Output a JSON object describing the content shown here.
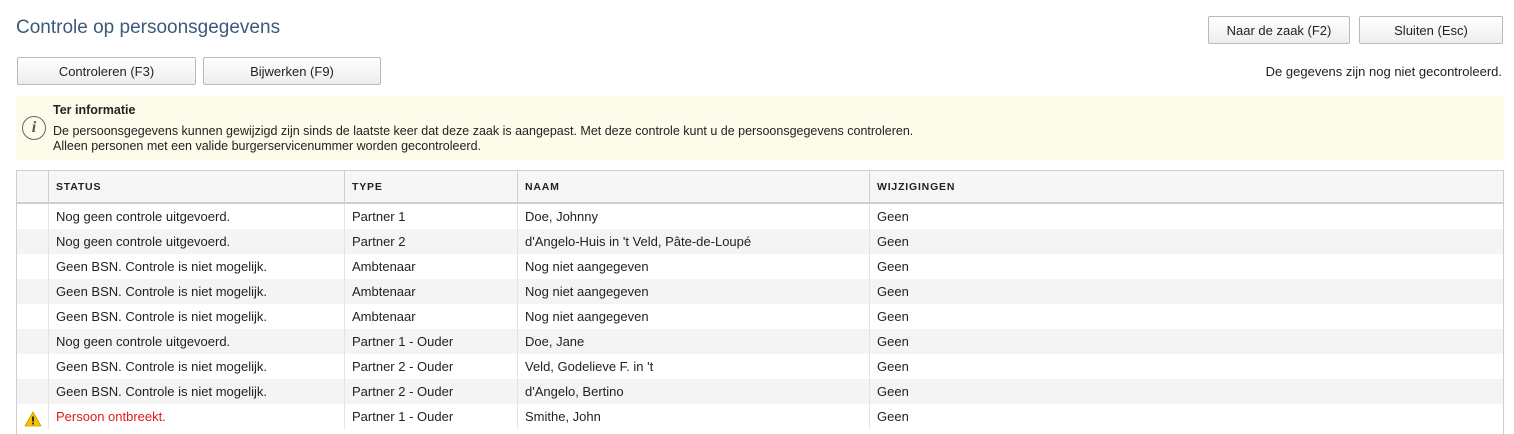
{
  "header": {
    "title": "Controle op persoonsgegevens",
    "naar_zaak_label": "Naar de zaak (F2)",
    "sluiten_label": "Sluiten (Esc)"
  },
  "toolbar": {
    "controleren_label": "Controleren (F3)",
    "bijwerken_label": "Bijwerken (F9)",
    "status_text": "De gegevens zijn nog niet gecontroleerd."
  },
  "info": {
    "title": "Ter informatie",
    "line1": "De persoonsgegevens kunnen gewijzigd zijn sinds de laatste keer dat deze zaak is aangepast. Met deze controle kunt u de persoonsgegevens controleren.",
    "line2": "Alleen personen met een valide burgerservicenummer worden gecontroleerd.",
    "icon": "info-icon"
  },
  "table": {
    "columns": [
      "STATUS",
      "TYPE",
      "NAAM",
      "WIJZIGINGEN"
    ],
    "rows": [
      {
        "status": "Nog geen controle uitgevoerd.",
        "type": "Partner 1",
        "naam": "Doe, Johnny",
        "wijzigingen": "Geen"
      },
      {
        "status": "Nog geen controle uitgevoerd.",
        "type": "Partner 2",
        "naam": "d'Angelo-Huis in 't Veld, Pâte-de-Loupé",
        "wijzigingen": "Geen"
      },
      {
        "status": "Geen BSN. Controle is niet mogelijk.",
        "type": "Ambtenaar",
        "naam": "Nog niet aangegeven",
        "wijzigingen": "Geen"
      },
      {
        "status": "Geen BSN. Controle is niet mogelijk.",
        "type": "Ambtenaar",
        "naam": "Nog niet aangegeven",
        "wijzigingen": "Geen"
      },
      {
        "status": "Geen BSN. Controle is niet mogelijk.",
        "type": "Ambtenaar",
        "naam": "Nog niet aangegeven",
        "wijzigingen": "Geen"
      },
      {
        "status": "Nog geen controle uitgevoerd.",
        "type": "Partner 1 - Ouder",
        "naam": "Doe, Jane",
        "wijzigingen": "Geen"
      },
      {
        "status": "Geen BSN. Controle is niet mogelijk.",
        "type": "Partner 2 - Ouder",
        "naam": "Veld, Godelieve F. in 't",
        "wijzigingen": "Geen"
      },
      {
        "status": "Geen BSN. Controle is niet mogelijk.",
        "type": "Partner 2 - Ouder",
        "naam": "d'Angelo, Bertino",
        "wijzigingen": "Geen"
      },
      {
        "status": "Persoon ontbreekt.",
        "type": "Partner 1 - Ouder",
        "naam": "Smithe, John",
        "wijzigingen": "Geen",
        "warning": true,
        "icon": "warning-icon"
      }
    ]
  },
  "colors": {
    "title": "#3b5a7a",
    "info_background": "#fdfbe9",
    "warning_text": "#e01a1a",
    "warning_icon": "#f5c400"
  }
}
